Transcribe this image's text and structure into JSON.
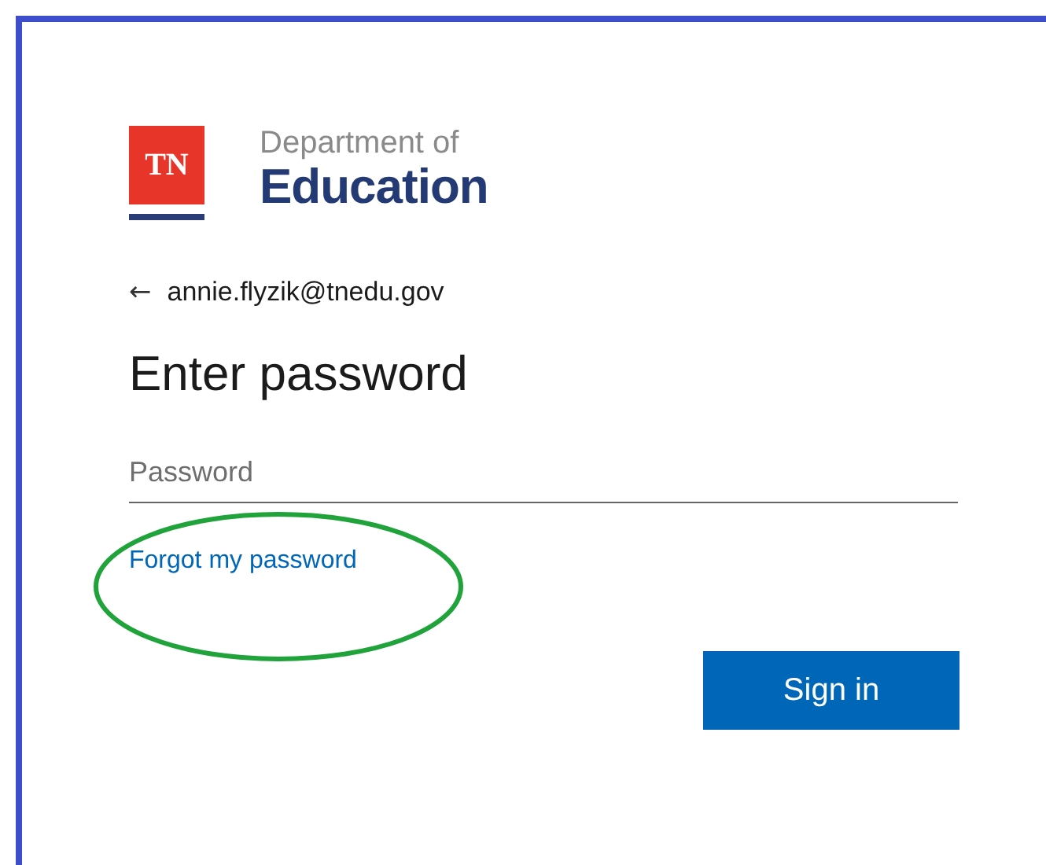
{
  "logo": {
    "mark": "TN",
    "line_1": "Department of",
    "line_2": "Education"
  },
  "account": {
    "back_arrow": "←",
    "email": "annie.flyzik@tnedu.gov"
  },
  "heading": "Enter password",
  "password_field": {
    "placeholder": "Password"
  },
  "forgot_link": {
    "label": "Forgot my password",
    "highlighted": true
  },
  "buttons": [
    "Sign in"
  ]
}
